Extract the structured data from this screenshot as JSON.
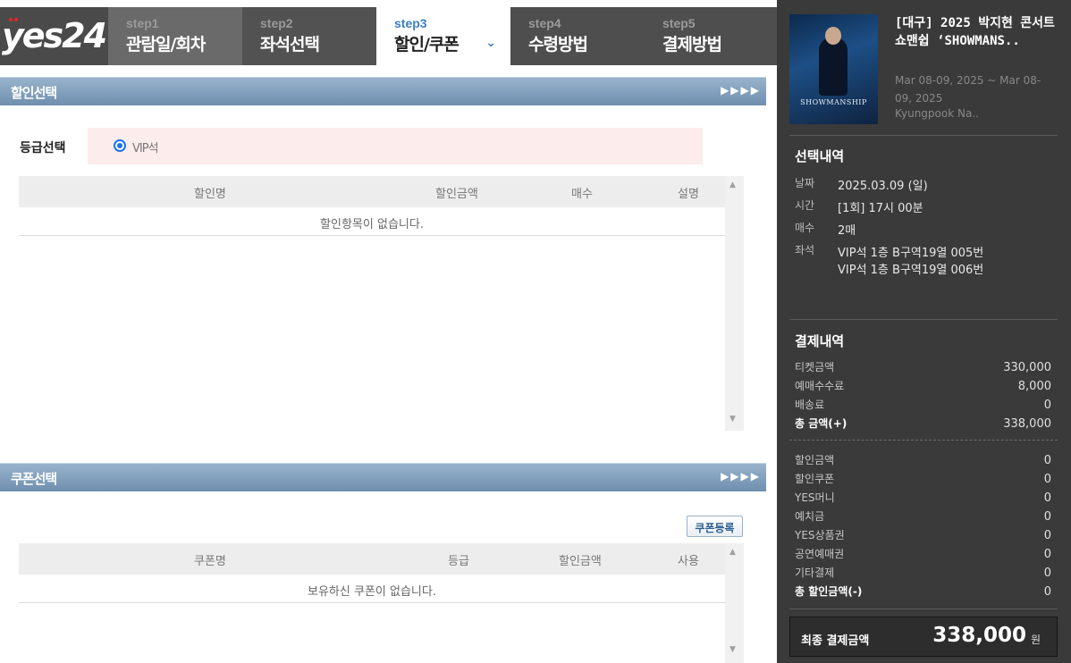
{
  "header": {
    "logo": "yes24",
    "steps": [
      {
        "num": "step1",
        "title": "관람일/회차"
      },
      {
        "num": "step2",
        "title": "좌석선택"
      },
      {
        "num": "step3",
        "title": "할인/쿠폰"
      },
      {
        "num": "step4",
        "title": "수령방법"
      },
      {
        "num": "step5",
        "title": "결제방법"
      }
    ]
  },
  "discount": {
    "title": "할인선택",
    "arrows": "▶▶▶▶",
    "grade_label": "등급선택",
    "grade_option": "VIP석",
    "columns": [
      "할인명",
      "할인금액",
      "매수",
      "설명"
    ],
    "empty_message": "할인항목이 없습니다."
  },
  "coupon": {
    "title": "쿠폰선택",
    "arrows": "▶▶▶▶",
    "register_button": "쿠폰등록",
    "columns": [
      "쿠폰명",
      "등급",
      "할인금액",
      "사용"
    ],
    "empty_message": "보유하신 쿠폰이 없습니다."
  },
  "show": {
    "poster_text": "SHOWMANSHIP",
    "title": "[대구] 2025 박지현 콘서트 쇼맨쉽 ‘SHOWMANS..",
    "date": "Mar 08-09, 2025 ~ Mar 08-09, 2025",
    "venue": "Kyungpook Na.."
  },
  "selection": {
    "title": "선택내역",
    "date_label": "날짜",
    "date": "2025.03.09 (일)",
    "time_label": "시간",
    "time": "[1회] 17시 00분",
    "qty_label": "매수",
    "qty": "2매",
    "seat_label": "좌석",
    "seats": [
      "VIP석 1층 B구역19열 005번",
      "VIP석 1층 B구역19열 006번"
    ]
  },
  "payment": {
    "title": "결제내역",
    "ticket_label": "티켓금액",
    "ticket": "330,000",
    "fee_label": "예매수수료",
    "fee": "8,000",
    "delivery_label": "배송료",
    "delivery": "0",
    "total_label": "총 금액(+)",
    "total": "338,000",
    "discount_label": "할인금액",
    "discount": "0",
    "coupon_label": "할인쿠폰",
    "coupon": "0",
    "yesmoney_label": "YES머니",
    "yesmoney": "0",
    "deposit_label": "예치금",
    "deposit": "0",
    "giftcard_label": "YES상품권",
    "giftcard": "0",
    "voucher_label": "공연예매권",
    "voucher": "0",
    "other_label": "기타결제",
    "other": "0",
    "total_discount_label": "총 할인금액(-)",
    "total_discount": "0",
    "final_label": "최종 결제금액",
    "final_amount": "338,000",
    "final_unit": "원"
  }
}
